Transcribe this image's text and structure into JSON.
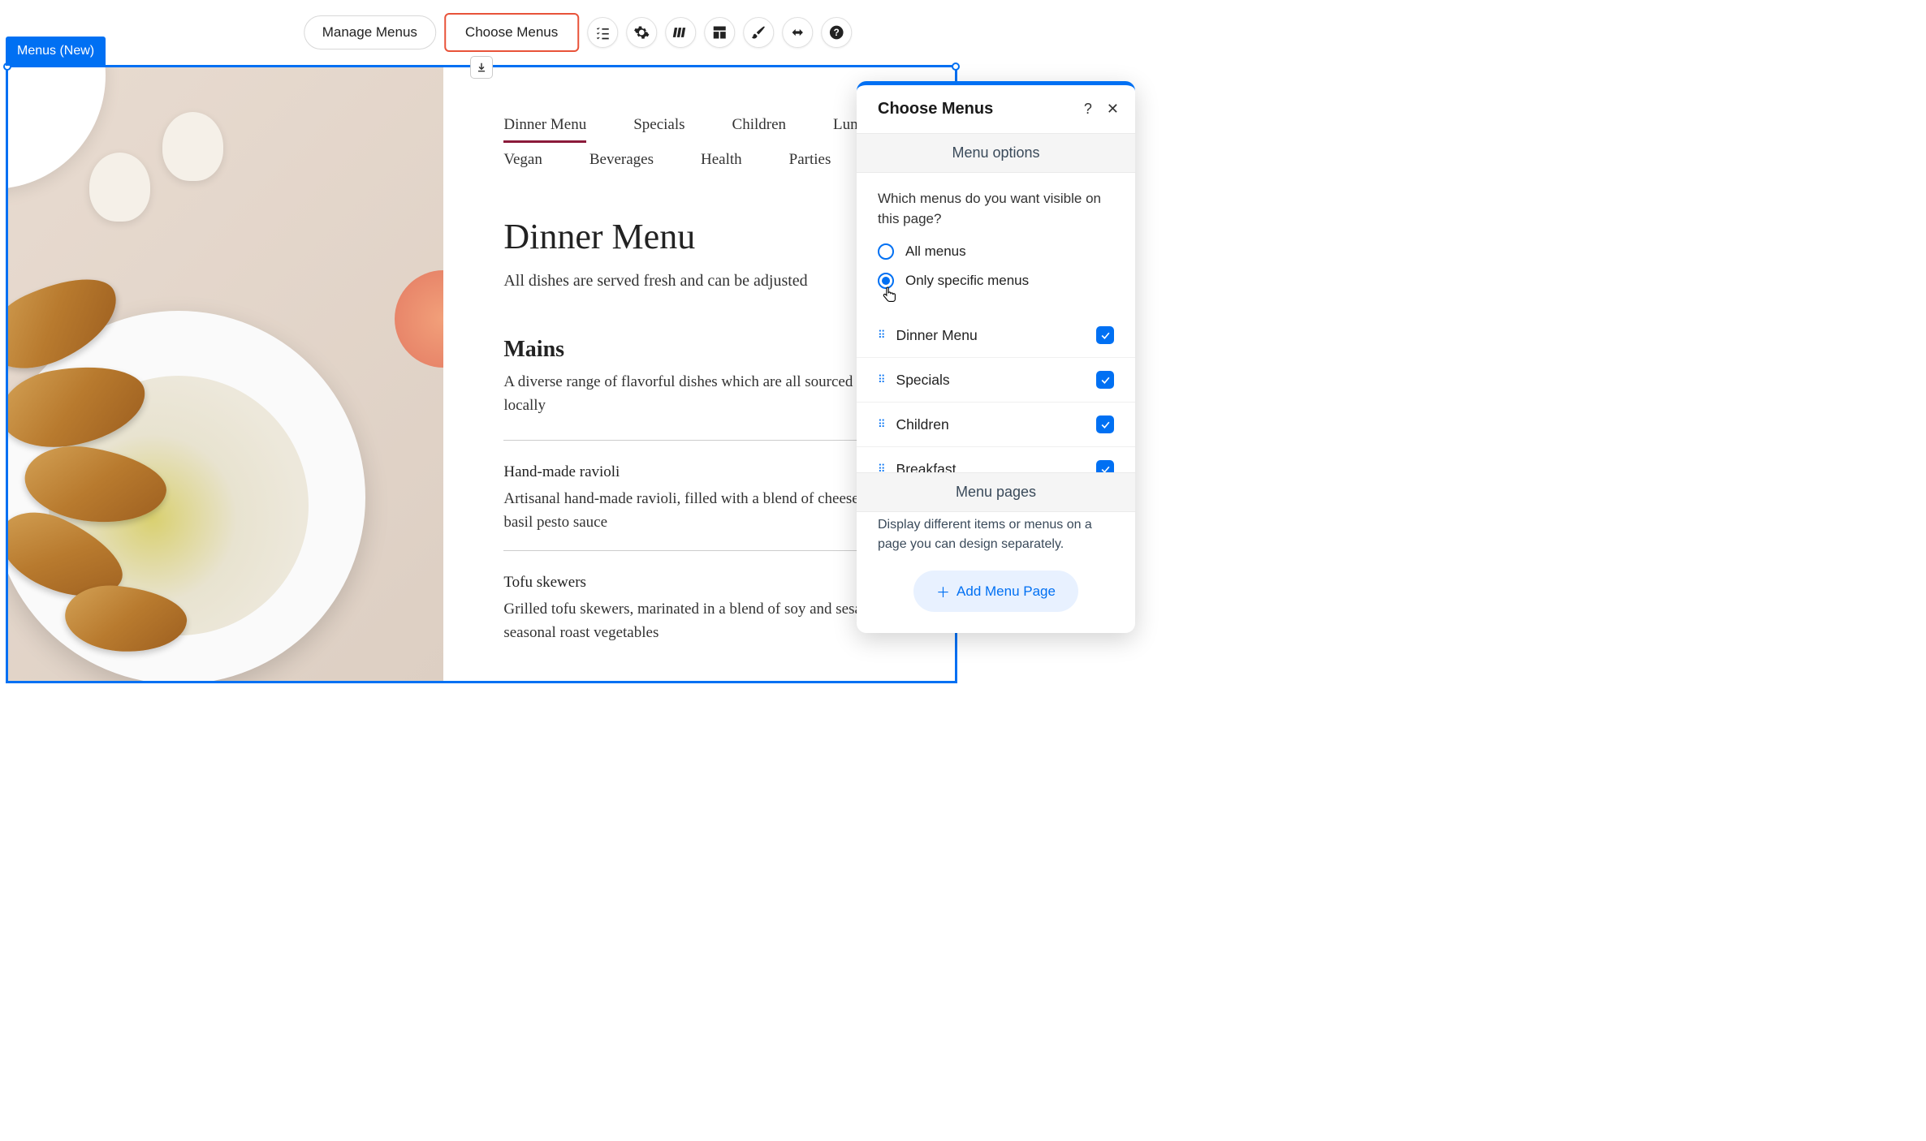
{
  "toolbar": {
    "manage_label": "Manage Menus",
    "choose_label": "Choose Menus"
  },
  "selection_label": "Menus (New)",
  "tabs": {
    "dinner": "Dinner Menu",
    "specials": "Specials",
    "children": "Children",
    "lunch": "Lunch",
    "vegan": "Vegan",
    "beverages": "Beverages",
    "health": "Health",
    "parties": "Parties"
  },
  "menu": {
    "title": "Dinner Menu",
    "subtitle": "All dishes are served fresh and can be adjusted",
    "section_title": "Mains",
    "section_desc": "A diverse range of flavorful dishes which are all sourced and locally",
    "dish1_name": "Hand-made ravioli",
    "dish1_desc": "Artisanal hand-made ravioli, filled with a blend of cheeses in a basil pesto sauce",
    "dish2_name": "Tofu skewers",
    "dish2_desc": "Grilled tofu skewers, marinated in a blend of soy and sesame with seasonal roast vegetables"
  },
  "panel": {
    "title": "Choose Menus",
    "section_options": "Menu options",
    "question": "Which menus do you want visible on this page?",
    "radio_all": "All menus",
    "radio_specific": "Only specific menus",
    "items": {
      "dinner": "Dinner Menu",
      "specials": "Specials",
      "children": "Children",
      "breakfast": "Breakfast"
    },
    "section_pages": "Menu pages",
    "pages_desc": "Display different items or menus on a page you can design separately.",
    "add_page_label": "Add Menu Page"
  }
}
